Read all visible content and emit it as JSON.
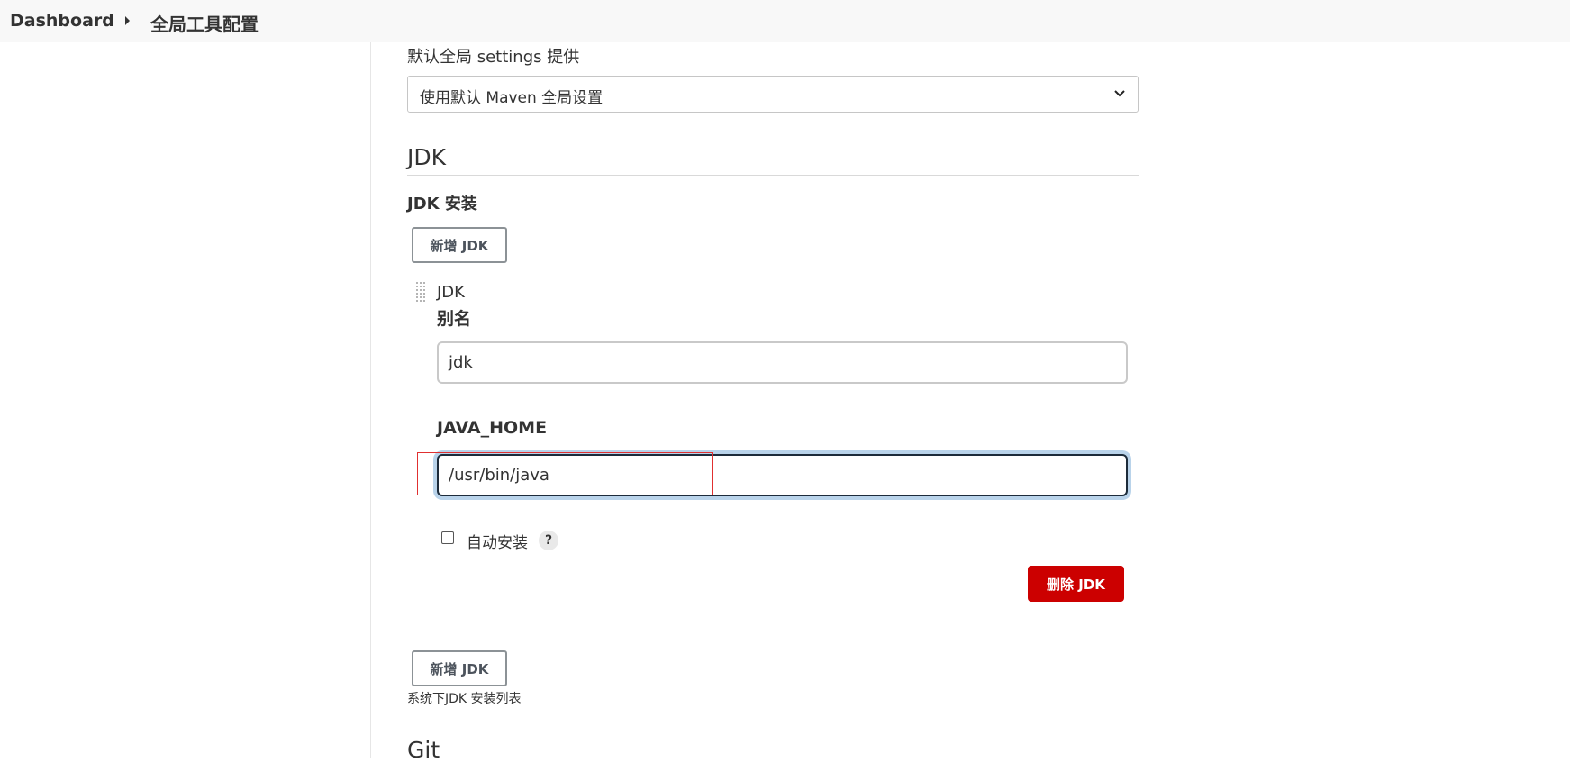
{
  "breadcrumb": {
    "home": "Dashboard",
    "current": "全局工具配置"
  },
  "maven_settings": {
    "label": "默认全局 settings 提供",
    "selected_value": "使用默认 Maven 全局设置"
  },
  "jdk_section": {
    "title": "JDK",
    "install_label": "JDK 安装",
    "add_button_label": "新增 JDK",
    "item": {
      "title": "JDK",
      "alias_label": "别名",
      "alias_value": "jdk",
      "java_home_label": "JAVA_HOME",
      "java_home_value": "/usr/bin/java",
      "auto_install_label": "自动安装",
      "auto_install_checked": false,
      "help_symbol": "?",
      "delete_button_label": "删除 JDK"
    },
    "add_button_bottom_label": "新增 JDK",
    "helper_text": "系统下JDK 安装列表"
  },
  "git_section": {
    "title": "Git"
  },
  "colors": {
    "danger": "#cc0000",
    "focus_ring": "#b9d3ea",
    "highlight": "#e03030"
  }
}
